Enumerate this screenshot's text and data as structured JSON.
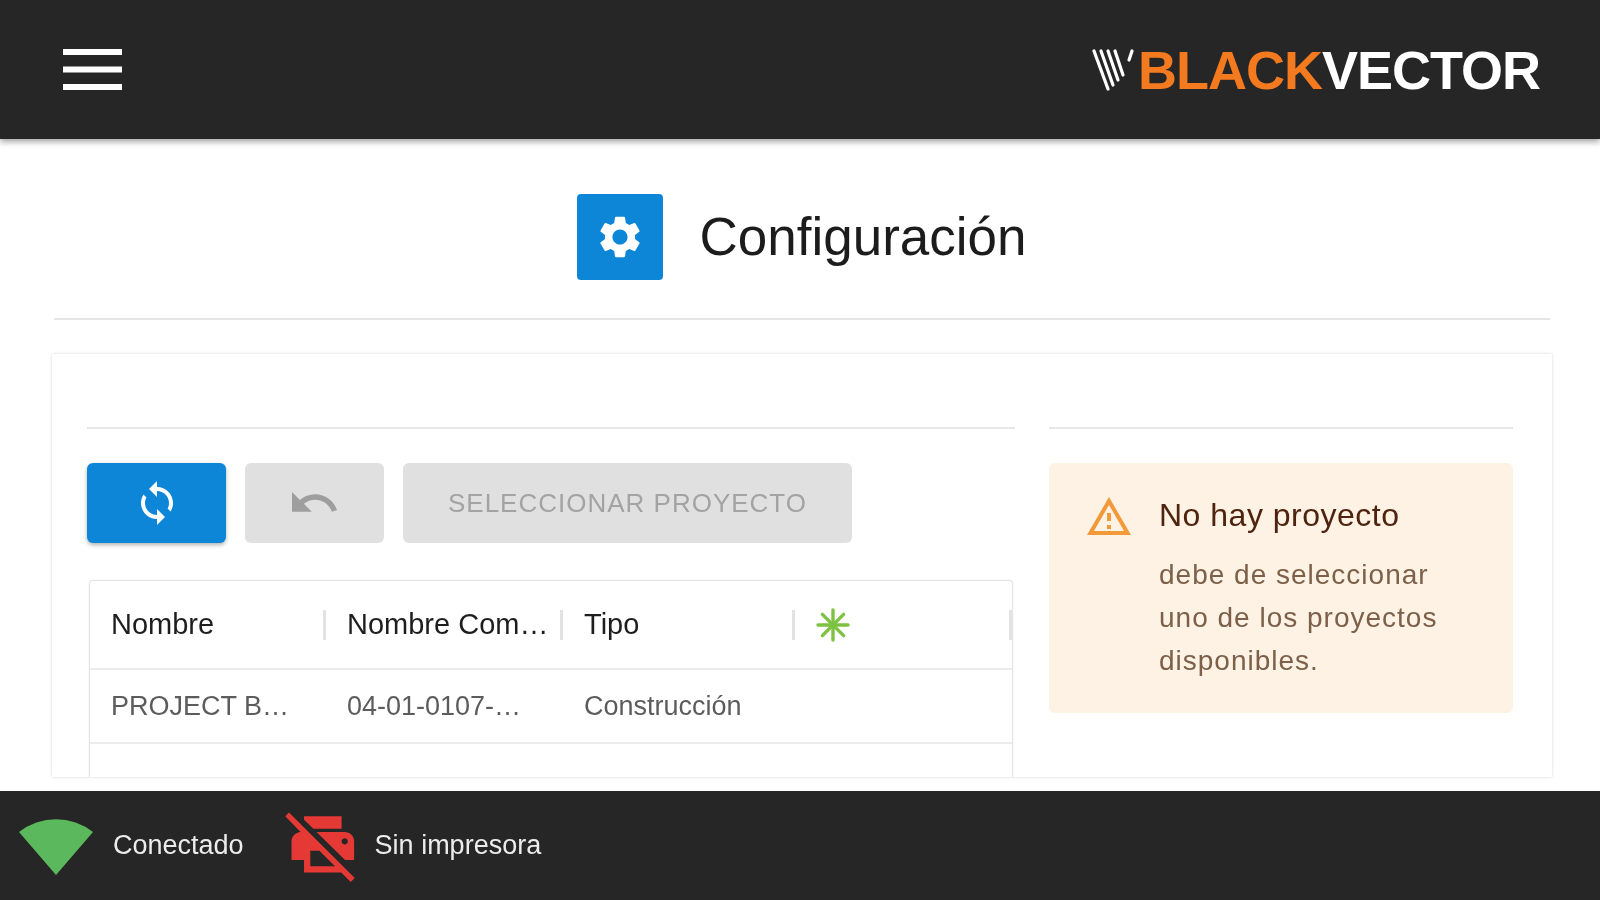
{
  "header": {
    "logo": {
      "first": "BLACK",
      "second": "VECTOR"
    }
  },
  "page": {
    "title": "Configuración"
  },
  "toolbar": {
    "refresh_button": {
      "disabled": false
    },
    "undo_button": {
      "disabled": true
    },
    "select_button": {
      "label": "SELECCIONAR PROYECTO",
      "disabled": true
    }
  },
  "table": {
    "columns": [
      {
        "kind": "text",
        "label": "Nombre"
      },
      {
        "kind": "text",
        "label": "Nombre Com…"
      },
      {
        "kind": "text",
        "label": "Tipo"
      },
      {
        "kind": "icon"
      }
    ],
    "rows": [
      {
        "cells": [
          "PROJECT B…",
          "04-01-0107-…",
          "Construcción"
        ]
      }
    ]
  },
  "alert": {
    "kind": "warning",
    "title": "No hay proyecto",
    "message": "debe de seleccionar uno de los proyectos disponibles."
  },
  "status_bar": [
    {
      "kind": "network",
      "label": "Conectado",
      "connected": true
    },
    {
      "kind": "printer",
      "label": "Sin impresora",
      "connected": false
    }
  ]
}
